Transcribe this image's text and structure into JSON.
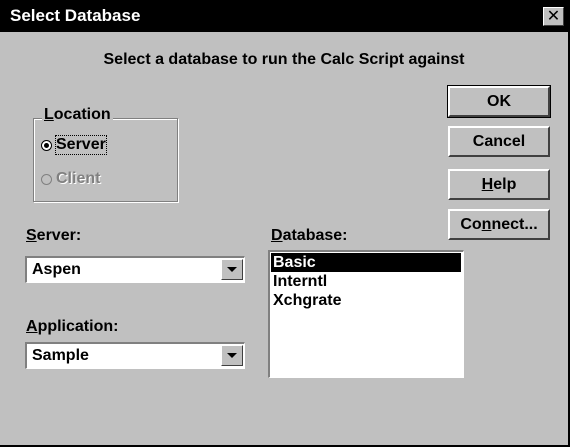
{
  "window": {
    "title": "Select Database",
    "close_glyph": "✕"
  },
  "prompt": "Select a database to run the Calc Script against",
  "location": {
    "label_mnemonic": "L",
    "label_rest": "ocation",
    "options": [
      {
        "label": "Server",
        "checked": true,
        "enabled": true
      },
      {
        "label": "Client",
        "checked": false,
        "enabled": false
      }
    ]
  },
  "buttons": {
    "ok": "OK",
    "cancel": "Cancel",
    "help_mnemonic": "H",
    "help_rest": "elp",
    "connect_pre": "Co",
    "connect_mnemonic": "n",
    "connect_rest": "nect..."
  },
  "server": {
    "label_mnemonic": "S",
    "label_rest": "erver:",
    "value": "Aspen"
  },
  "application": {
    "label_mnemonic": "A",
    "label_rest": "pplication:",
    "value": "Sample"
  },
  "database": {
    "label_mnemonic": "D",
    "label_rest": "atabase:",
    "items": [
      "Basic",
      "Interntl",
      "Xchgrate"
    ],
    "selected_index": 0
  },
  "icons": {
    "close": "close-icon",
    "dropdown": "chevron-down-icon",
    "radio": "radio-button-icon"
  },
  "colors": {
    "face": "#c0c0c0",
    "titlebar": "#000000",
    "selection": "#000000",
    "disabled_text": "#808080"
  }
}
